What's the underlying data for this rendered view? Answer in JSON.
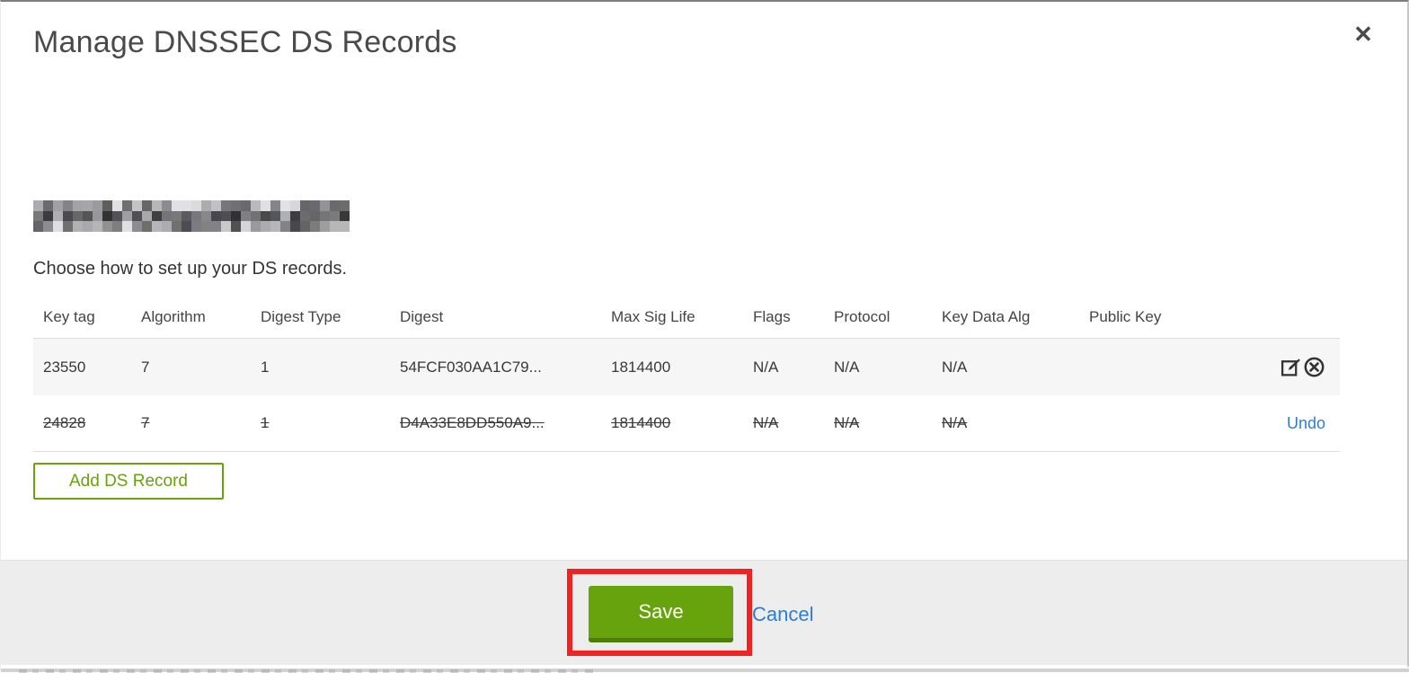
{
  "dialog": {
    "title": "Manage DNSSEC DS Records",
    "close_icon": "✕"
  },
  "domain": {
    "redacted": true
  },
  "intro": "Choose how to set up your DS records.",
  "table": {
    "columns": [
      "Key tag",
      "Algorithm",
      "Digest Type",
      "Digest",
      "Max Sig Life",
      "Flags",
      "Protocol",
      "Key Data Alg",
      "Public Key"
    ],
    "rows": [
      {
        "cells": [
          "23550",
          "7",
          "1",
          "54FCF030AA1C79...",
          "1814400",
          "N/A",
          "N/A",
          "N/A",
          ""
        ],
        "state": "active",
        "actions": [
          "edit",
          "delete"
        ]
      },
      {
        "cells": [
          "24828",
          "7",
          "1",
          "D4A33E8DD550A9...",
          "1814400",
          "N/A",
          "N/A",
          "N/A",
          ""
        ],
        "state": "marked-for-deletion",
        "undo_label": "Undo"
      }
    ]
  },
  "buttons": {
    "add_ds_record": "Add DS Record",
    "save": "Save",
    "cancel": "Cancel"
  },
  "annotation": {
    "type": "red-highlight-rectangle",
    "target": "save-button",
    "color": "#ee2424"
  },
  "colors": {
    "green": "#67a30c",
    "green_dark": "#4f7d08",
    "link_blue": "#2e7dd1",
    "red_annotation": "#ee2424",
    "footer_bg": "#ededed",
    "row_alt_bg": "#f6f6f6"
  }
}
